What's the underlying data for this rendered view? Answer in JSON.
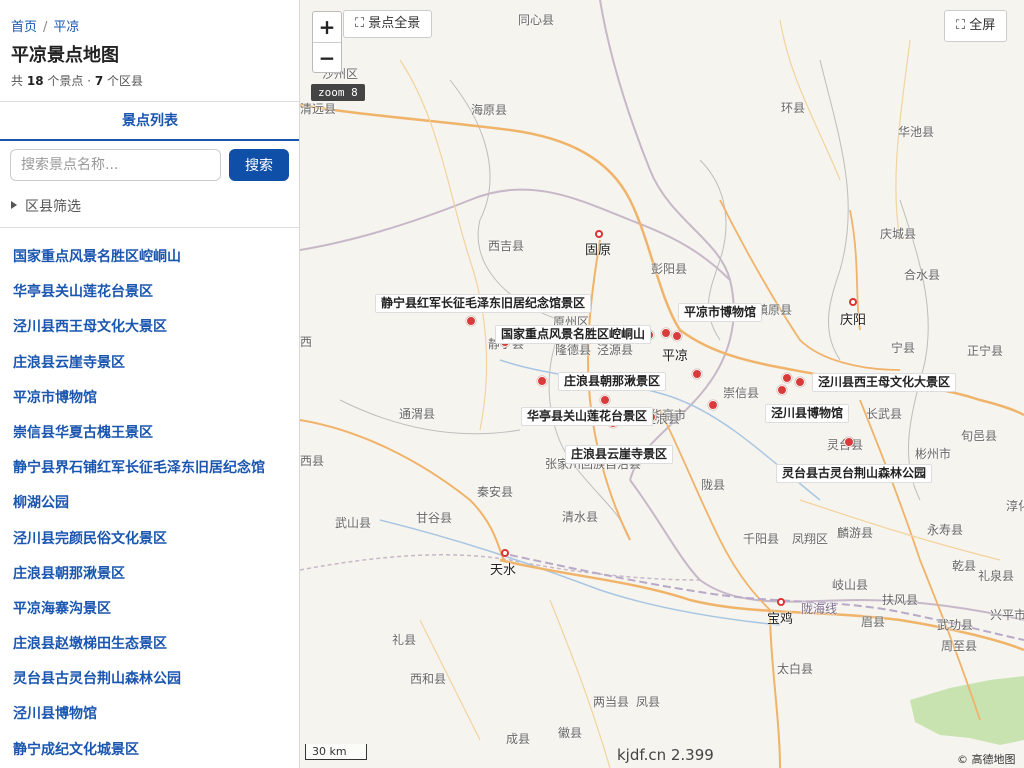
{
  "breadcrumb": {
    "home": "首页",
    "separator": "/",
    "current": "平凉"
  },
  "header": {
    "title": "平凉景点地图",
    "stats_prefix": "共",
    "spot_count": "18",
    "stats_mid": "个景点 ·",
    "district_count": "7",
    "stats_suffix": "个区县"
  },
  "tabs": {
    "list": "景点列表"
  },
  "search": {
    "placeholder": "搜索景点名称...",
    "button": "搜索"
  },
  "filter": {
    "label": "区县筛选"
  },
  "spots": [
    "国家重点风景名胜区崆峒山",
    "华亭县关山莲花台景区",
    "泾川县西王母文化大景区",
    "庄浪县云崖寺景区",
    "平凉市博物馆",
    "崇信县华夏古槐王景区",
    "静宁县界石铺红军长征毛泽东旧居纪念馆",
    "柳湖公园",
    "泾川县完颜民俗文化景区",
    "庄浪县朝那湫景区",
    "平凉海寨沟景区",
    "庄浪县赵墩梯田生态景区",
    "灵台县古灵台荆山森林公园",
    "泾川县博物馆",
    "静宁成纪文化城景区"
  ],
  "map": {
    "overview_button": "景点全景",
    "fullscreen_button": "全屏",
    "zoom_in": "+",
    "zoom_out": "−",
    "zoom_level": "zoom 8",
    "scale": "30 km",
    "watermark": "kjdf.cn 2.399",
    "attribution": "© 高德地图",
    "fullscreen_icon": "expand-icon",
    "colors": {
      "marker": "#d93a3a",
      "road_major": "#f0b36a",
      "road_minor": "#f3d39e",
      "rail": "#b9a9c9",
      "border": "#c7b8c9",
      "river": "#a8c6e3",
      "forest": "#c8e2b0",
      "link": "#1a56b0"
    },
    "spot_labels": [
      "静宁县红军长征毛泽东旧居纪念馆景区",
      "国家重点风景名胜区崆峒山",
      "平凉市博物馆",
      "庄浪县朝那湫景区",
      "泾川县西王母文化大景区",
      "华亭县关山莲花台景区",
      "泾川县博物馆",
      "庄浪县云崖寺景区",
      "灵台县古灵台荆山森林公园"
    ],
    "cities": [
      "固原",
      "平凉",
      "庆阳",
      "天水",
      "宝鸡"
    ],
    "places": [
      "同心县",
      "环县",
      "华池县",
      "海原县",
      "西吉县",
      "彭阳县",
      "庆城县",
      "合水县",
      "原州区",
      "隆德县",
      "泾源县",
      "镇原县",
      "宁县",
      "正宁县",
      "崇信县",
      "长武县",
      "旬邑县",
      "彬州市",
      "灵台县",
      "张家川回族自治县",
      "华亭市",
      "通渭县",
      "秦安县",
      "清水县",
      "甘谷县",
      "武山县",
      "陇县",
      "千阳县",
      "麟游县",
      "永寿县",
      "凤翔区",
      "岐山县",
      "扶风县",
      "乾县",
      "礼泉县",
      "眉县",
      "武功县",
      "周至县",
      "太白县",
      "礼县",
      "西和县",
      "两当县",
      "凤县",
      "徽县",
      "成县",
      "淳化县",
      "兴平市",
      "静宁县",
      "庄浪县",
      "沙州区",
      "清远县"
    ],
    "railway_label": "陇海线",
    "edge_labels": [
      "西",
      "西县"
    ]
  }
}
